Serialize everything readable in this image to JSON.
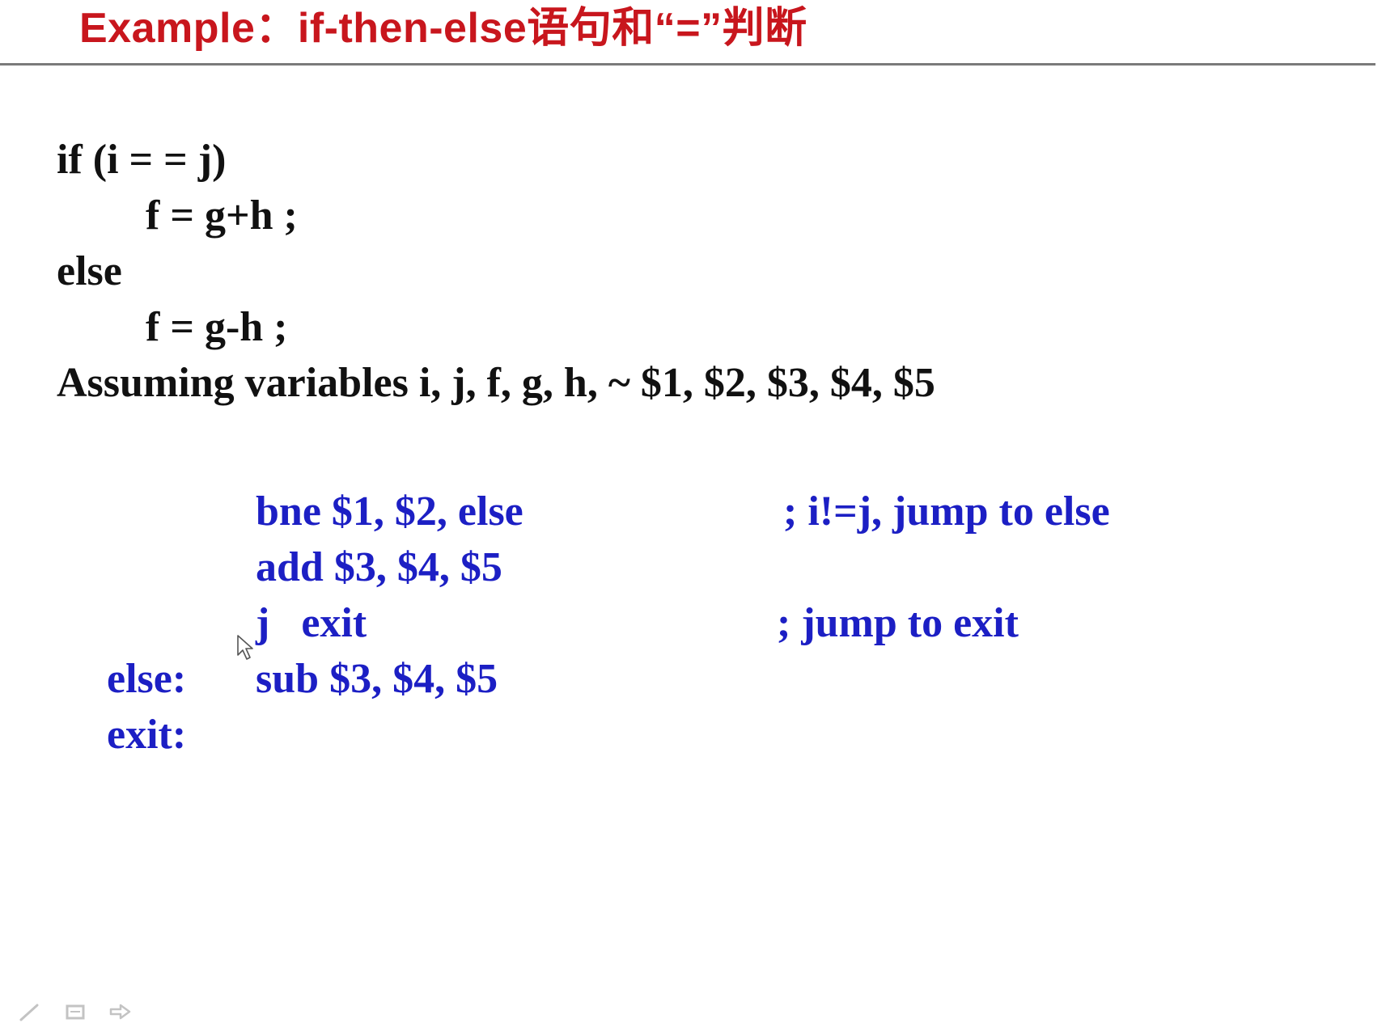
{
  "slide": {
    "title": "Example：if-then-else语句和“=”判断"
  },
  "source_code": {
    "lines": [
      "if (i = = j)",
      "f = g+h ;",
      "else",
      "f = g-h ;"
    ],
    "assumption": "Assuming variables i, j, f, g, h, ~ $1, $2, $3, $4, $5"
  },
  "assembly": {
    "lines": [
      {
        "label": "",
        "instruction": "bne $1, $2, else",
        "comment": "; i!=j, jump to else"
      },
      {
        "label": "",
        "instruction": "add $3, $4, $5",
        "comment": ""
      },
      {
        "label": "",
        "instruction": "j   exit",
        "comment": "; jump to exit"
      },
      {
        "label": "else:",
        "instruction": "sub $3, $4, $5",
        "comment": ""
      },
      {
        "label": "exit:",
        "instruction": "",
        "comment": ""
      }
    ]
  },
  "toolbar": {
    "icons": [
      "pen-icon",
      "slide-menu-icon",
      "next-arrow-icon"
    ]
  },
  "colors": {
    "title": "#c8161d",
    "code": "#111111",
    "assembly": "#1c1fc4",
    "rule": "#7a7a7a"
  }
}
